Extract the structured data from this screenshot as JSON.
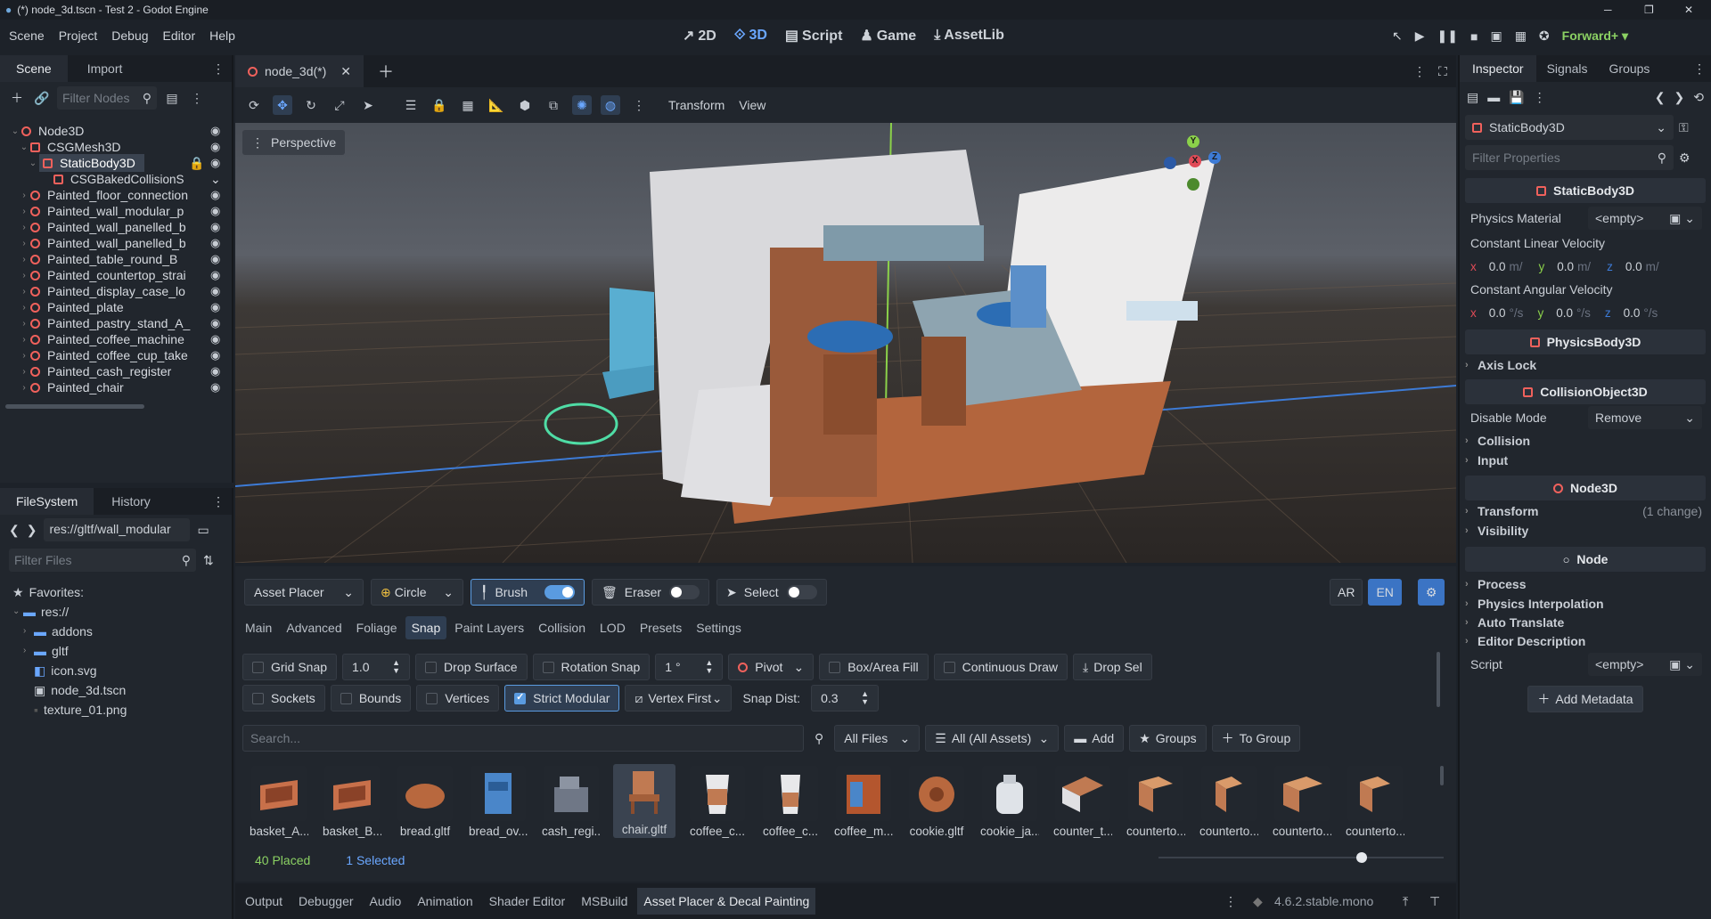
{
  "window": {
    "title": "(*) node_3d.tscn - Test 2 - Godot Engine"
  },
  "menu": [
    "Scene",
    "Project",
    "Debug",
    "Editor",
    "Help"
  ],
  "workspaces": {
    "w2d": "2D",
    "w3d": "3D",
    "script": "Script",
    "game": "Game",
    "assetlib": "AssetLib"
  },
  "renderer": "Forward+",
  "scene_dock": {
    "tabs": [
      "Scene",
      "Import"
    ],
    "filter_placeholder": "Filter Nodes",
    "nodes": [
      {
        "label": "Node3D"
      },
      {
        "label": "CSGMesh3D"
      },
      {
        "label": "StaticBody3D"
      },
      {
        "label": "CSGBakedCollisionS"
      },
      {
        "label": "Painted_floor_connection"
      },
      {
        "label": "Painted_wall_modular_p"
      },
      {
        "label": "Painted_wall_panelled_b"
      },
      {
        "label": "Painted_wall_panelled_b"
      },
      {
        "label": "Painted_table_round_B"
      },
      {
        "label": "Painted_countertop_strai"
      },
      {
        "label": "Painted_display_case_lo"
      },
      {
        "label": "Painted_plate"
      },
      {
        "label": "Painted_pastry_stand_A_"
      },
      {
        "label": "Painted_coffee_machine"
      },
      {
        "label": "Painted_coffee_cup_take"
      },
      {
        "label": "Painted_cash_register"
      },
      {
        "label": "Painted_chair"
      }
    ]
  },
  "fs_dock": {
    "tabs": [
      "FileSystem",
      "History"
    ],
    "path": "res://gltf/wall_modular",
    "filter_placeholder": "Filter Files",
    "favorites": "Favorites:",
    "root": "res://",
    "items": [
      {
        "label": "addons"
      },
      {
        "label": "gltf"
      },
      {
        "label": "icon.svg"
      },
      {
        "label": "node_3d.tscn"
      },
      {
        "label": "texture_01.png"
      }
    ]
  },
  "editor_tab": {
    "label": "node_3d(*)"
  },
  "viewport_toolbar": {
    "transform": "Transform",
    "view": "View",
    "perspective": "Perspective"
  },
  "gizmo": {
    "x": "X",
    "y": "Y",
    "z": "Z"
  },
  "asset_placer": {
    "mode": "Asset Placer",
    "shape": "Circle",
    "brush": "Brush",
    "eraser": "Eraser",
    "select": "Select",
    "lang": [
      "AR",
      "EN"
    ],
    "tabs": [
      "Main",
      "Advanced",
      "Foliage",
      "Snap",
      "Paint Layers",
      "Collision",
      "LOD",
      "Presets",
      "Settings"
    ],
    "active_tab": "Snap",
    "grid_snap": "Grid Snap",
    "grid_val": "1.0",
    "drop_surface": "Drop Surface",
    "rotation_snap": "Rotation Snap",
    "rot_val": "1 °",
    "pivot": "Pivot",
    "box_fill": "Box/Area Fill",
    "continuous": "Continuous Draw",
    "drop_sel": "Drop Sel",
    "sockets": "Sockets",
    "bounds": "Bounds",
    "vertices": "Vertices",
    "strict": "Strict Modular",
    "vertex_first": "Vertex First",
    "snap_dist_label": "Snap Dist:",
    "snap_dist": "0.3",
    "search_placeholder": "Search...",
    "all_files": "All Files",
    "all_assets": "All (All Assets)",
    "add": "Add",
    "groups": "Groups",
    "to_group": "To Group",
    "assets": [
      "basket_A....",
      "basket_B....",
      "bread.gltf",
      "bread_ov...",
      "cash_regi...",
      "chair.gltf",
      "coffee_c...",
      "coffee_c...",
      "coffee_m...",
      "cookie.gltf",
      "cookie_ja...",
      "counter_t...",
      "counterto...",
      "counterto...",
      "counterto...",
      "counterto..."
    ],
    "placed": "40 Placed",
    "selected": "1 Selected"
  },
  "bottom_tabs": [
    "Output",
    "Debugger",
    "Audio",
    "Animation",
    "Shader Editor",
    "MSBuild",
    "Asset Placer & Decal Painting"
  ],
  "version": "4.6.2.stable.mono",
  "inspector": {
    "tabs": [
      "Inspector",
      "Signals",
      "Groups"
    ],
    "node": "StaticBody3D",
    "filter_placeholder": "Filter Properties",
    "sec_static": "StaticBody3D",
    "physics_material": "Physics Material",
    "empty": "<empty>",
    "const_lin": "Constant Linear Velocity",
    "lin": [
      "0.0",
      "0.0",
      "0.0"
    ],
    "lin_unit": "m/",
    "const_ang": "Constant Angular Velocity",
    "ang": [
      "0.0",
      "0.0",
      "0.0"
    ],
    "ang_unit": "°/s",
    "axis": [
      "x",
      "y",
      "z"
    ],
    "sec_physics": "PhysicsBody3D",
    "axis_lock": "Axis Lock",
    "sec_coll": "CollisionObject3D",
    "disable_mode": "Disable Mode",
    "disable_val": "Remove",
    "collision": "Collision",
    "input": "Input",
    "sec_node3d": "Node3D",
    "transform": "Transform",
    "transform_note": "(1 change)",
    "visibility": "Visibility",
    "sec_node": "Node",
    "process": "Process",
    "phys_interp": "Physics Interpolation",
    "auto_translate": "Auto Translate",
    "editor_desc": "Editor Description",
    "script": "Script",
    "add_metadata": "Add Metadata"
  }
}
